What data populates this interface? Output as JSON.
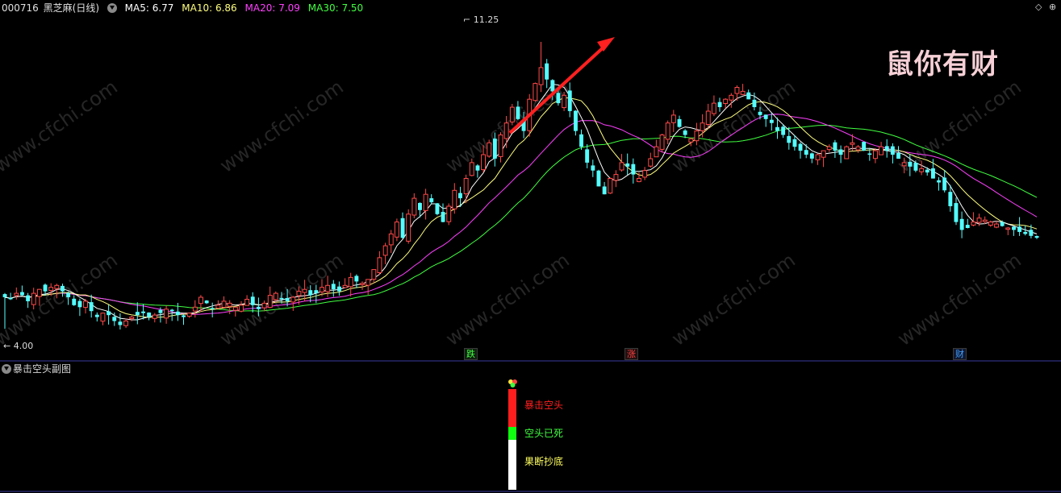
{
  "header": {
    "stock_code": "000716",
    "stock_name": "黑芝麻(日线)",
    "indicators": [
      {
        "label": "MA5: 6.77",
        "color": "#ffffff"
      },
      {
        "label": "MA10: 6.86",
        "color": "#ffff7f"
      },
      {
        "label": "MA20: 7.09",
        "color": "#ff40ff"
      },
      {
        "label": "MA30: 7.50",
        "color": "#40ff40"
      }
    ]
  },
  "window_controls": {
    "left": "◇",
    "right": "⊕"
  },
  "sub_chart": {
    "title": "暴击空头副图",
    "legend": [
      {
        "label": "暴击空头",
        "color": "#ff2020"
      },
      {
        "label": "空头已死",
        "color": "#40ff40"
      },
      {
        "label": "果断抄底",
        "color": "#ffff60"
      }
    ]
  },
  "brand_text": "鼠你有财",
  "watermark_text": "www.cfchi.com",
  "signal_tags": [
    {
      "label": "跌",
      "color": "#40ff40"
    },
    {
      "label": "涨",
      "color": "#ff4040"
    },
    {
      "label": "财",
      "color": "#40a0ff"
    }
  ],
  "annotations": {
    "high_label": "11.25",
    "low_label": "4.00"
  },
  "chart_data": {
    "type": "candlestick",
    "ylim": [
      3.6,
      11.9
    ],
    "high": 11.25,
    "low": 4.0,
    "colors": {
      "up": "#ff4a4a",
      "down": "#54ffff",
      "ma5": "#ffffff",
      "ma10": "#ffff7f",
      "ma20": "#ff40ff",
      "ma30": "#40ff40"
    },
    "closes": [
      4.8,
      4.75,
      4.9,
      4.85,
      4.7,
      4.9,
      5.0,
      4.95,
      5.05,
      5.1,
      4.95,
      4.8,
      4.6,
      4.55,
      4.7,
      4.45,
      4.3,
      4.4,
      4.35,
      4.2,
      4.1,
      4.2,
      4.3,
      4.35,
      4.4,
      4.3,
      4.35,
      4.4,
      4.5,
      4.45,
      4.35,
      4.3,
      4.4,
      4.55,
      4.8,
      4.65,
      4.5,
      4.6,
      4.7,
      4.65,
      4.55,
      4.6,
      4.75,
      4.6,
      4.5,
      4.65,
      4.85,
      4.9,
      4.75,
      4.7,
      4.8,
      4.95,
      5.0,
      4.85,
      4.9,
      5.05,
      5.1,
      5.0,
      4.95,
      5.1,
      5.3,
      5.2,
      5.15,
      5.25,
      5.5,
      5.8,
      6.1,
      6.4,
      6.7,
      6.3,
      6.9,
      7.3,
      7.0,
      7.4,
      7.2,
      6.9,
      6.7,
      7.1,
      7.5,
      7.3,
      7.8,
      8.2,
      8.0,
      8.4,
      8.7,
      8.3,
      8.9,
      9.2,
      9.6,
      9.3,
      9.0,
      9.8,
      10.2,
      10.6,
      10.3,
      10.0,
      9.7,
      9.9,
      9.5,
      9.0,
      8.6,
      8.2,
      8.0,
      7.6,
      7.4,
      7.8,
      7.9,
      8.2,
      8.1,
      7.9,
      7.8,
      8.0,
      8.3,
      8.6,
      8.9,
      9.2,
      9.4,
      9.1,
      8.9,
      8.8,
      9.0,
      9.2,
      9.5,
      9.7,
      9.6,
      9.8,
      9.9,
      10.1,
      10.0,
      9.8,
      9.6,
      9.4,
      9.3,
      9.2,
      9.0,
      8.9,
      8.7,
      8.6,
      8.5,
      8.4,
      8.3,
      8.4,
      8.5,
      8.6,
      8.5,
      8.4,
      8.6,
      8.7,
      8.6,
      8.5,
      8.4,
      8.5,
      8.6,
      8.5,
      8.4,
      8.3,
      8.2,
      8.1,
      8.0,
      8.05,
      7.95,
      7.8,
      7.7,
      7.5,
      7.1,
      6.7,
      6.5,
      6.55,
      6.7,
      6.8,
      6.75,
      6.7,
      6.65,
      6.6,
      6.55,
      6.5,
      6.45,
      6.4,
      6.35,
      6.3
    ]
  }
}
